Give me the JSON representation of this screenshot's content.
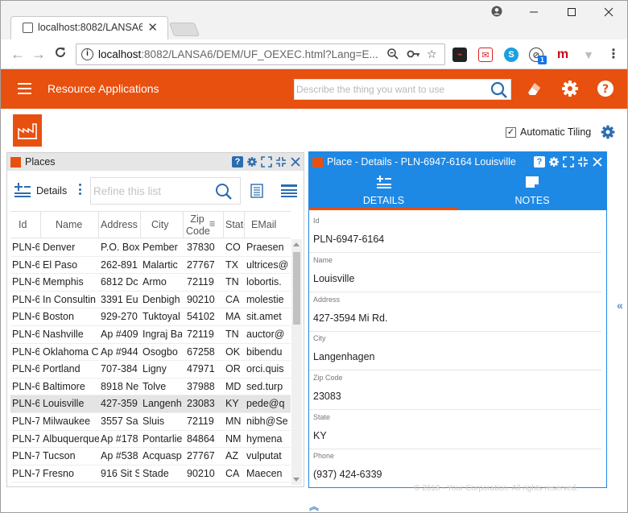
{
  "browser": {
    "tab_title": "localhost:8082/LANSA6/",
    "url_host": "localhost",
    "url_rest": ":8082/LANSA6/DEM/UF_OEXEC.html?Lang=E...",
    "ext_badge": "1"
  },
  "header": {
    "title": "Resource Applications",
    "search_placeholder": "Describe the thing you want to use"
  },
  "toolbar": {
    "auto_tiling_label": "Automatic Tiling",
    "auto_tiling_checked": "✓"
  },
  "places": {
    "title": "Places",
    "details_label": "Details",
    "refine_placeholder": "Refine this list",
    "columns": [
      "Id",
      "Name",
      "Address",
      "City",
      "Zip Code",
      "State",
      "EMail"
    ],
    "rows": [
      [
        "PLN-6",
        "Denver",
        "P.O. Box",
        "Pember",
        "37830",
        "CO",
        "Praesen"
      ],
      [
        "PLN-6",
        "El Paso",
        "262-891",
        "Malartic",
        "27767",
        "TX",
        "ultrices@"
      ],
      [
        "PLN-6",
        "Memphis",
        "6812 Dc",
        "Armo",
        "72119",
        "TN",
        "lobortis."
      ],
      [
        "PLN-6",
        "In Consultin",
        "3391 Eu",
        "Denbigh",
        "90210",
        "CA",
        "molestie"
      ],
      [
        "PLN-6",
        "Boston",
        "929-270",
        "Tuktoyal",
        "54102",
        "MA",
        "sit.amet"
      ],
      [
        "PLN-6",
        "Nashville",
        "Ap #409",
        "Ingraj Ba",
        "72119",
        "TN",
        "auctor@"
      ],
      [
        "PLN-6",
        "Oklahoma C",
        "Ap #944",
        "Osogbo",
        "67258",
        "OK",
        "bibendu"
      ],
      [
        "PLN-6",
        "Portland",
        "707-384",
        "Ligny",
        "47971",
        "OR",
        "orci.quis"
      ],
      [
        "PLN-6",
        "Baltimore",
        "8918 Ne",
        "Tolve",
        "37988",
        "MD",
        "sed.turp"
      ],
      [
        "PLN-6",
        "Louisville",
        "427-359",
        "Langenh",
        "23083",
        "KY",
        "pede@q"
      ],
      [
        "PLN-7",
        "Milwaukee",
        "3557 Sa",
        "Sluis",
        "72119",
        "MN",
        "nibh@Se"
      ],
      [
        "PLN-7",
        "Albuquerque",
        "Ap #178",
        "Pontarlie",
        "84864",
        "NM",
        "hymena"
      ],
      [
        "PLN-7",
        "Tucson",
        "Ap #538",
        "Acquasp",
        "27767",
        "AZ",
        "vulputat"
      ],
      [
        "PLN-7",
        "Fresno",
        "916 Sit S",
        "Stade",
        "90210",
        "CA",
        "Maecen"
      ]
    ],
    "selected_row": 9
  },
  "details": {
    "title": "Place - Details - PLN-6947-6164 Louisville",
    "tabs": [
      "DETAILS",
      "NOTES"
    ],
    "fields": [
      {
        "label": "Id",
        "value": "PLN-6947-6164"
      },
      {
        "label": "Name",
        "value": "Louisville"
      },
      {
        "label": "Address",
        "value": "427-3594 Mi Rd."
      },
      {
        "label": "City",
        "value": "Langenhagen"
      },
      {
        "label": "Zip Code",
        "value": "23083"
      },
      {
        "label": "State",
        "value": "KY"
      },
      {
        "label": "Phone",
        "value": "(937) 424-6339"
      }
    ]
  },
  "footer": {
    "copyright": "© 2018 - Your Corporation. All rights reserved."
  },
  "colors": {
    "brand_orange": "#e8500f",
    "accent_blue": "#1e88e5"
  }
}
